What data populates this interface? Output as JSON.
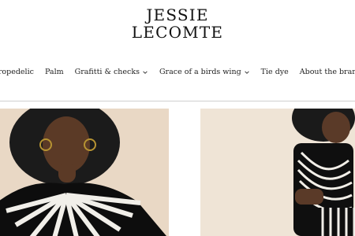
{
  "brand": {
    "line1": "JESSIE",
    "line2": "LECOMTE"
  },
  "nav": {
    "items": [
      {
        "label": "Tropedelic",
        "has_dropdown": false
      },
      {
        "label": "Palm",
        "has_dropdown": false
      },
      {
        "label": "Grafitti & checks",
        "has_dropdown": true
      },
      {
        "label": "Grace of a birds wing",
        "has_dropdown": true
      },
      {
        "label": "Tie dye",
        "has_dropdown": false
      },
      {
        "label": "About the brand",
        "has_dropdown": false
      }
    ]
  }
}
